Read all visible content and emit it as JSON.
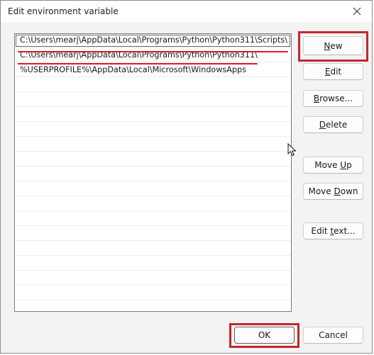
{
  "window": {
    "title": "Edit environment variable",
    "close_icon": "close-icon"
  },
  "list": {
    "items": [
      "C:\\Users\\mearj\\AppData\\Local\\Programs\\Python\\Python311\\Scripts\\",
      "C:\\Users\\mearj\\AppData\\Local\\Programs\\Python\\Python311\\",
      "%USERPROFILE%\\AppData\\Local\\Microsoft\\WindowsApps"
    ],
    "selected_index": 0
  },
  "buttons": {
    "new": {
      "label": "New",
      "mnemonic_index": 0
    },
    "edit": {
      "label": "Edit",
      "mnemonic_index": 0
    },
    "browse": {
      "label": "Browse...",
      "mnemonic_index": 0
    },
    "delete": {
      "label": "Delete",
      "mnemonic_index": 0
    },
    "move_up": {
      "label": "Move Up",
      "mnemonic_index": 5
    },
    "move_down": {
      "label": "Move Down",
      "mnemonic_index": 5
    },
    "edit_text": {
      "label": "Edit text...",
      "mnemonic_index": 5
    },
    "ok": {
      "label": "OK"
    },
    "cancel": {
      "label": "Cancel"
    }
  },
  "colors": {
    "annotation_red": "#c1272d",
    "dialog_bg": "#f3f3f3"
  }
}
